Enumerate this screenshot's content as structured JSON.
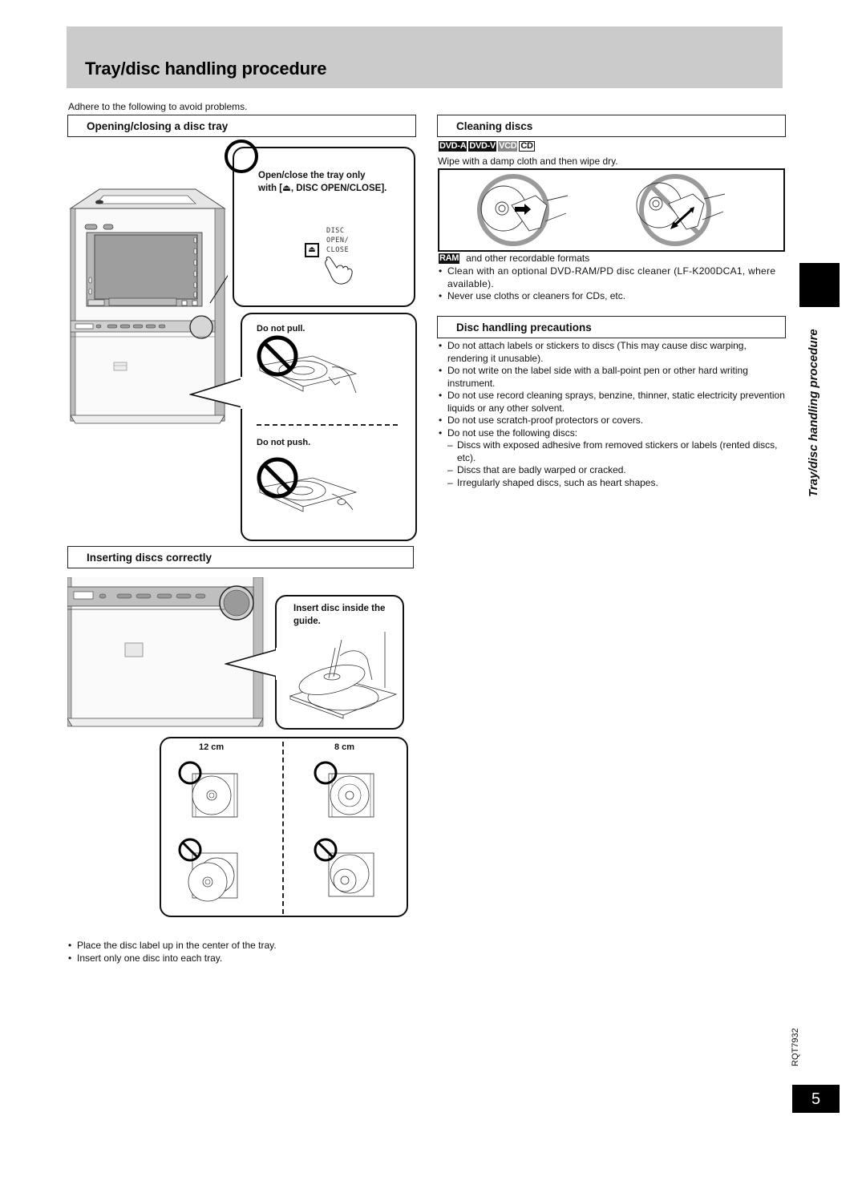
{
  "page": {
    "title": "Tray/disc handling procedure",
    "intro": "Adhere to the following to avoid problems.",
    "side_tab_label": "Tray/disc handling procedure",
    "doc_code": "RQT7932",
    "page_number": "5"
  },
  "opening_closing": {
    "heading": "Opening/closing a disc tray",
    "callout_ok": "Open/close the tray only with [⏏, DISC OPEN/CLOSE].",
    "callout_ok_line1": "Open/close the tray only",
    "callout_ok_line2": "with [⏏, DISC OPEN/CLOSE].",
    "button_label_lines": [
      "DISC",
      "OPEN/",
      "CLOSE"
    ],
    "button_icon": "eject-icon",
    "do_not_pull": "Do not pull.",
    "do_not_push": "Do not push."
  },
  "inserting": {
    "heading": "Inserting discs correctly",
    "callout": "Insert disc inside the guide.",
    "callout_line1": "Insert disc inside the",
    "callout_line2": "guide.",
    "sizes": [
      "12 cm",
      "8 cm"
    ],
    "notes": [
      "Place the disc label up in the center of the tray.",
      "Insert only one disc into each tray."
    ]
  },
  "cleaning": {
    "heading": "Cleaning discs",
    "badges": [
      {
        "label": "DVD-A",
        "style": "dark"
      },
      {
        "label": "DVD-V",
        "style": "dark"
      },
      {
        "label": "VCD",
        "style": "grey"
      },
      {
        "label": "CD",
        "style": "outline"
      }
    ],
    "instruction": "Wipe with a damp cloth and then wipe dry.",
    "ram_badge": "RAM",
    "ram_text": "and other recordable formats",
    "ram_bullets": [
      "Clean with an optional DVD-RAM/PD disc cleaner (LF-K200DCA1, where available).",
      "Never use cloths or cleaners for CDs, etc."
    ]
  },
  "precautions": {
    "heading": "Disc handling precautions",
    "bullets": [
      "Do not attach labels or stickers to discs (This may cause disc warping, rendering it unusable).",
      "Do not write on the label side with a ball-point pen or other hard writing instrument.",
      "Do not use record cleaning sprays, benzine, thinner, static electricity prevention liquids or any other solvent.",
      "Do not use scratch-proof protectors or covers.",
      "Do not use the following discs:"
    ],
    "sub_items": [
      "Discs with exposed adhesive from removed stickers or labels (rented discs, etc).",
      "Discs that are badly warped or cracked.",
      "Irregularly shaped discs, such as heart shapes."
    ]
  },
  "colors": {
    "title_bar": "#cbcbcb",
    "prohibit_grey": "#9a9a9a",
    "badge_dark": "#111111",
    "badge_grey": "#8a8a8a"
  }
}
